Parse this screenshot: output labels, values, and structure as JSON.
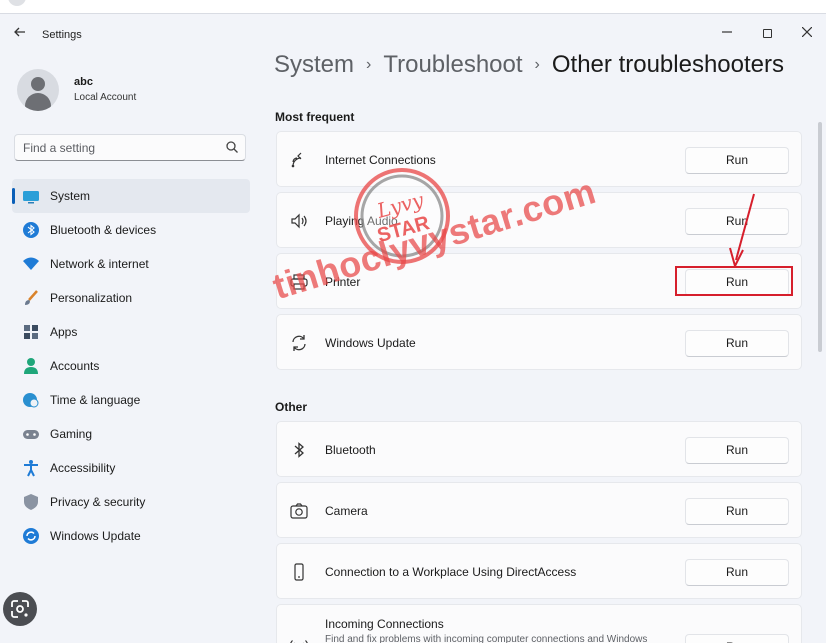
{
  "window": {
    "app_title": "Settings"
  },
  "profile": {
    "name": "abc",
    "account_type": "Local Account"
  },
  "search": {
    "placeholder": "Find a setting"
  },
  "sidebar": {
    "items": [
      {
        "label": "System",
        "icon": "monitor-icon",
        "active": true
      },
      {
        "label": "Bluetooth & devices",
        "icon": "bluetooth-icon"
      },
      {
        "label": "Network & internet",
        "icon": "wifi-icon"
      },
      {
        "label": "Personalization",
        "icon": "brush-icon"
      },
      {
        "label": "Apps",
        "icon": "apps-icon"
      },
      {
        "label": "Accounts",
        "icon": "person-icon"
      },
      {
        "label": "Time & language",
        "icon": "globe-clock-icon"
      },
      {
        "label": "Gaming",
        "icon": "gamepad-icon"
      },
      {
        "label": "Accessibility",
        "icon": "accessibility-icon"
      },
      {
        "label": "Privacy & security",
        "icon": "shield-icon"
      },
      {
        "label": "Windows Update",
        "icon": "update-icon"
      }
    ]
  },
  "breadcrumb": {
    "level1": "System",
    "level2": "Troubleshoot",
    "current": "Other troubleshooters",
    "separator": "›"
  },
  "sections": {
    "most_frequent": {
      "heading": "Most frequent",
      "items": [
        {
          "title": "Internet Connections",
          "action": "Run",
          "icon": "network-icon"
        },
        {
          "title": "Playing Audio",
          "action": "Run",
          "icon": "speaker-icon"
        },
        {
          "title": "Printer",
          "action": "Run",
          "icon": "printer-icon"
        },
        {
          "title": "Windows Update",
          "action": "Run",
          "icon": "refresh-icon"
        }
      ]
    },
    "other": {
      "heading": "Other",
      "items": [
        {
          "title": "Bluetooth",
          "action": "Run",
          "icon": "bluetooth-icon"
        },
        {
          "title": "Camera",
          "action": "Run",
          "icon": "camera-icon"
        },
        {
          "title": "Connection to a Workplace Using DirectAccess",
          "action": "Run",
          "icon": "phone-icon"
        },
        {
          "title": "Incoming Connections",
          "subtitle": "Find and fix problems with incoming computer connections and Windows",
          "action": "Run",
          "icon": "broadcast-icon"
        }
      ]
    }
  },
  "watermark": {
    "logo_text_top": "Lyvy",
    "logo_text_bottom": "STAR",
    "site": "tinhoclyvystar.com"
  },
  "colors": {
    "accent": "#0a5fb8",
    "highlight": "#d61f2c",
    "watermark": "#e84646"
  }
}
